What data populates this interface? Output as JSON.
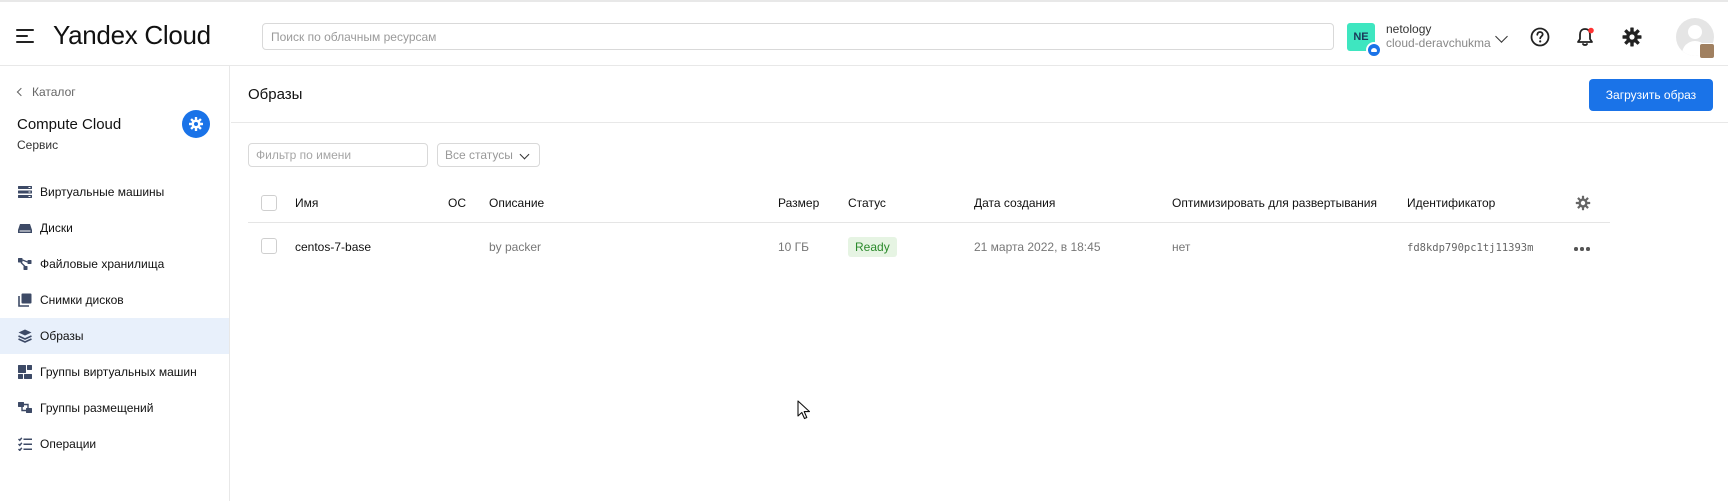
{
  "header": {
    "app_title": "Yandex Cloud",
    "search_placeholder": "Поиск по облачным ресурсам",
    "account": {
      "initials": "NE",
      "name": "netology",
      "cloud": "cloud-deravchukma"
    },
    "icons": [
      "menu-icon",
      "help-icon",
      "bell-icon",
      "gear-icon",
      "user-avatar"
    ]
  },
  "sidebar": {
    "back_label": "Каталог",
    "service_title": "Compute Cloud",
    "service_subtitle": "Сервис",
    "items": [
      {
        "label": "Виртуальные машины",
        "icon": "vm-icon",
        "active": false
      },
      {
        "label": "Диски",
        "icon": "disk-icon",
        "active": false
      },
      {
        "label": "Файловые хранилища",
        "icon": "filestore-icon",
        "active": false
      },
      {
        "label": "Снимки дисков",
        "icon": "snapshot-icon",
        "active": false
      },
      {
        "label": "Образы",
        "icon": "image-layers-icon",
        "active": true
      },
      {
        "label": "Группы виртуальных машин",
        "icon": "vm-group-icon",
        "active": false
      },
      {
        "label": "Группы размещений",
        "icon": "placement-icon",
        "active": false
      },
      {
        "label": "Операции",
        "icon": "operations-icon",
        "active": false
      }
    ]
  },
  "main": {
    "title": "Образы",
    "upload_button": "Загрузить образ",
    "filter_placeholder": "Фильтр по имени",
    "status_filter": "Все статусы",
    "table": {
      "headers": {
        "name": "Имя",
        "os": "ОС",
        "description": "Описание",
        "size": "Размер",
        "status": "Статус",
        "created": "Дата создания",
        "optimize": "Оптимизировать для развертывания",
        "id": "Идентификатор"
      },
      "rows": [
        {
          "name": "centos-7-base",
          "os": "",
          "description": "by packer",
          "size": "10 ГБ",
          "status": "Ready",
          "created": "21 марта 2022, в 18:45",
          "optimize": "нет",
          "id": "fd8kdp790pc1tj11393m"
        }
      ]
    }
  },
  "colors": {
    "accent": "#1a73e8",
    "active_nav_bg": "#e8f0fb",
    "status_ready_bg": "#e6f4e3",
    "status_ready_text": "#2b8a2b"
  }
}
